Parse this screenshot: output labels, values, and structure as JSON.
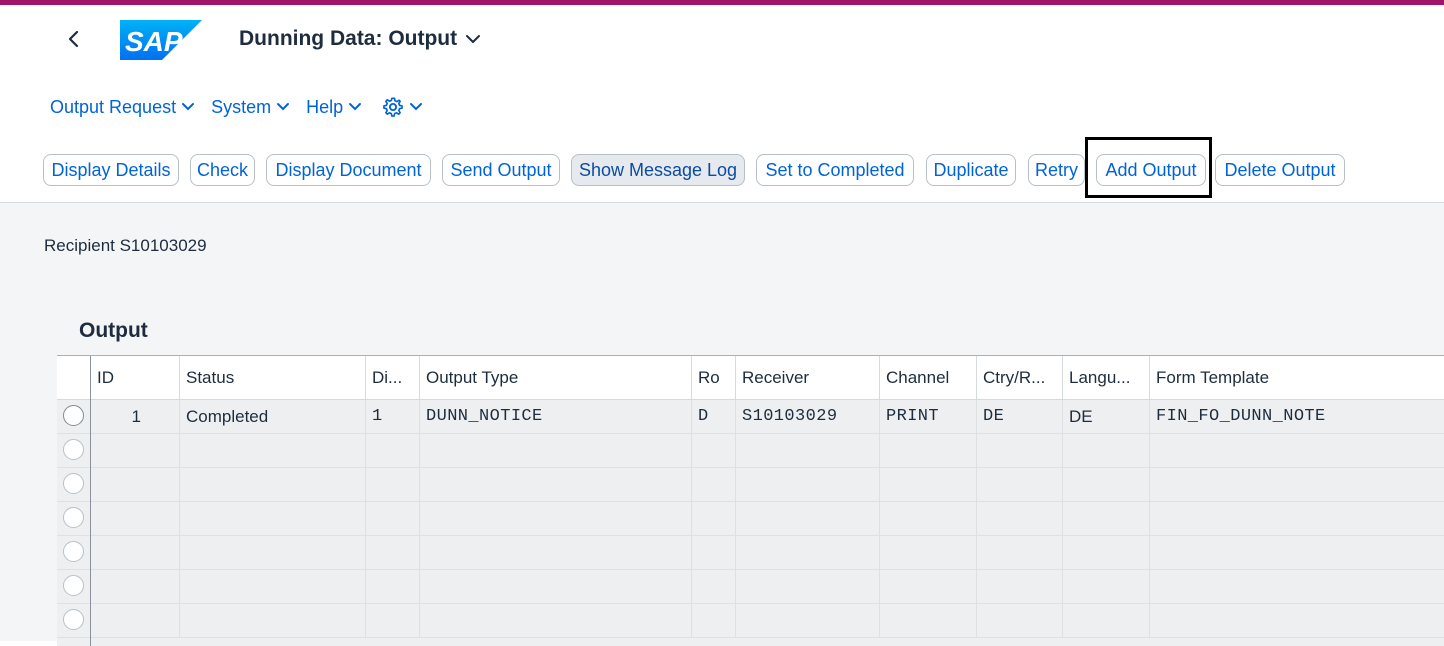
{
  "app": {
    "title": "Dunning Data: Output",
    "logo_text": "SAP"
  },
  "menu": {
    "items": [
      "Output Request",
      "System",
      "Help"
    ],
    "settings_icon": "gear-icon"
  },
  "toolbar": {
    "buttons": [
      "Display Details",
      "Check",
      "Display Document",
      "Send Output",
      "Show Message Log",
      "Set to Completed",
      "Duplicate",
      "Retry",
      "Add Output",
      "Delete Output"
    ],
    "pressed_button": "Show Message Log",
    "highlighted_button": "Add Output"
  },
  "content": {
    "recipient": "Recipient S10103029",
    "section_title": "Output"
  },
  "table": {
    "columns": [
      "ID",
      "Status",
      "Di...",
      "Output Type",
      "Ro",
      "Receiver",
      "Channel",
      "Ctry/R...",
      "Langu...",
      "Form Template"
    ],
    "rows": [
      {
        "id": "1",
        "status": "Completed",
        "di": "1",
        "output_type": "DUNN_NOTICE",
        "ro": "D",
        "receiver": "S10103029",
        "channel": "PRINT",
        "ctry": "DE",
        "language": "DE",
        "form_template": "FIN_FO_DUNN_NOTE"
      }
    ],
    "empty_rows": 6
  },
  "colors": {
    "accent": "#0064d9",
    "top_bar": "#a2146c",
    "logo_blue": "#0070f2"
  }
}
